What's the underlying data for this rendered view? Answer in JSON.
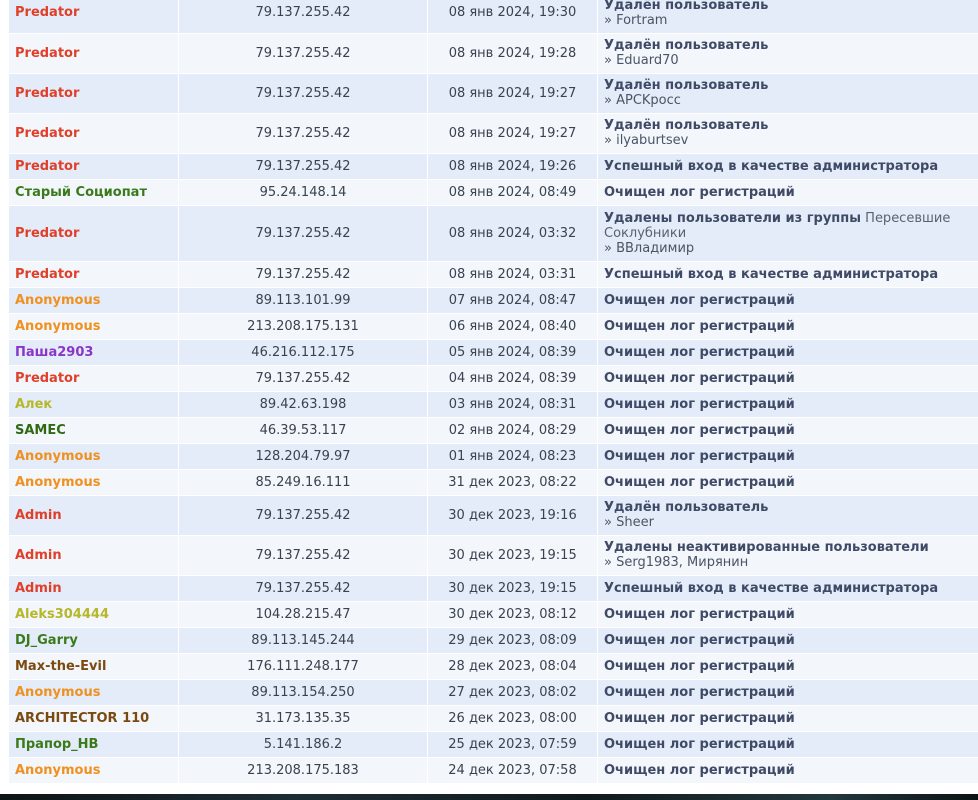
{
  "colors": {
    "predator": "#e0402a",
    "admin": "#e0402a",
    "anonymous": "#f0901f",
    "green": "#3a7a1a",
    "purple": "#8a35c8",
    "olive": "#b5b82a",
    "brown": "#7a4a10"
  },
  "rows": [
    {
      "user": "Predator",
      "color": "#e0402a",
      "ip": "79.137.255.42",
      "time": "08 янв 2024, 19:30",
      "action": "Удалён пользователь",
      "extra": "",
      "sub": "» Fortram",
      "h": 40
    },
    {
      "user": "Predator",
      "color": "#e0402a",
      "ip": "79.137.255.42",
      "time": "08 янв 2024, 19:28",
      "action": "Удалён пользователь",
      "extra": "",
      "sub": "» Eduard70",
      "h": 40
    },
    {
      "user": "Predator",
      "color": "#e0402a",
      "ip": "79.137.255.42",
      "time": "08 янв 2024, 19:27",
      "action": "Удалён пользователь",
      "extra": "",
      "sub": "» APCKpocc",
      "h": 40
    },
    {
      "user": "Predator",
      "color": "#e0402a",
      "ip": "79.137.255.42",
      "time": "08 янв 2024, 19:27",
      "action": "Удалён пользователь",
      "extra": "",
      "sub": "» ilyaburtsev",
      "h": 40
    },
    {
      "user": "Predator",
      "color": "#e0402a",
      "ip": "79.137.255.42",
      "time": "08 янв 2024, 19:26",
      "action": "Успешный вход в качестве администратора",
      "extra": "",
      "sub": "",
      "h": 26
    },
    {
      "user": "Старый Социопат",
      "color": "#3a7a1a",
      "ip": "95.24.148.14",
      "time": "08 янв 2024, 08:49",
      "action": "Очищен лог регистраций",
      "extra": "",
      "sub": "",
      "h": 26
    },
    {
      "user": "Predator",
      "color": "#e0402a",
      "ip": "79.137.255.42",
      "time": "08 янв 2024, 03:32",
      "action": "Удалены пользователи из группы",
      "extra": " Пересевшие Соклубники",
      "sub": "» ВВладимир",
      "h": 56
    },
    {
      "user": "Predator",
      "color": "#e0402a",
      "ip": "79.137.255.42",
      "time": "08 янв 2024, 03:31",
      "action": "Успешный вход в качестве администратора",
      "extra": "",
      "sub": "",
      "h": 26
    },
    {
      "user": "Anonymous",
      "color": "#f0901f",
      "ip": "89.113.101.99",
      "time": "07 янв 2024, 08:47",
      "action": "Очищен лог регистраций",
      "extra": "",
      "sub": "",
      "h": 26
    },
    {
      "user": "Anonymous",
      "color": "#f0901f",
      "ip": "213.208.175.131",
      "time": "06 янв 2024, 08:40",
      "action": "Очищен лог регистраций",
      "extra": "",
      "sub": "",
      "h": 26
    },
    {
      "user": "Паша2903",
      "color": "#8a35c8",
      "ip": "46.216.112.175",
      "time": "05 янв 2024, 08:39",
      "action": "Очищен лог регистраций",
      "extra": "",
      "sub": "",
      "h": 26
    },
    {
      "user": "Predator",
      "color": "#e0402a",
      "ip": "79.137.255.42",
      "time": "04 янв 2024, 08:39",
      "action": "Очищен лог регистраций",
      "extra": "",
      "sub": "",
      "h": 26
    },
    {
      "user": "Алек",
      "color": "#b5b82a",
      "ip": "89.42.63.198",
      "time": "03 янв 2024, 08:31",
      "action": "Очищен лог регистраций",
      "extra": "",
      "sub": "",
      "h": 26
    },
    {
      "user": "SAMEC",
      "color": "#2f6a12",
      "ip": "46.39.53.117",
      "time": "02 янв 2024, 08:29",
      "action": "Очищен лог регистраций",
      "extra": "",
      "sub": "",
      "h": 26
    },
    {
      "user": "Anonymous",
      "color": "#f0901f",
      "ip": "128.204.79.97",
      "time": "01 янв 2024, 08:23",
      "action": "Очищен лог регистраций",
      "extra": "",
      "sub": "",
      "h": 26
    },
    {
      "user": "Anonymous",
      "color": "#f0901f",
      "ip": "85.249.16.111",
      "time": "31 дек 2023, 08:22",
      "action": "Очищен лог регистраций",
      "extra": "",
      "sub": "",
      "h": 26
    },
    {
      "user": "Admin",
      "color": "#e0402a",
      "ip": "79.137.255.42",
      "time": "30 дек 2023, 19:16",
      "action": "Удалён пользователь",
      "extra": "",
      "sub": "» Sheer",
      "h": 40
    },
    {
      "user": "Admin",
      "color": "#e0402a",
      "ip": "79.137.255.42",
      "time": "30 дек 2023, 19:15",
      "action": "Удалены неактивированные пользователи",
      "extra": "",
      "sub": "» Serg1983, Мирянин",
      "h": 40
    },
    {
      "user": "Admin",
      "color": "#e0402a",
      "ip": "79.137.255.42",
      "time": "30 дек 2023, 19:15",
      "action": "Успешный вход в качестве администратора",
      "extra": "",
      "sub": "",
      "h": 26
    },
    {
      "user": "Aleks304444",
      "color": "#b5b82a",
      "ip": "104.28.215.47",
      "time": "30 дек 2023, 08:12",
      "action": "Очищен лог регистраций",
      "extra": "",
      "sub": "",
      "h": 26
    },
    {
      "user": "DJ_Garry",
      "color": "#3a7a1a",
      "ip": "89.113.145.244",
      "time": "29 дек 2023, 08:09",
      "action": "Очищен лог регистраций",
      "extra": "",
      "sub": "",
      "h": 26
    },
    {
      "user": "Max-the-Evil",
      "color": "#7a4a10",
      "ip": "176.111.248.177",
      "time": "28 дек 2023, 08:04",
      "action": "Очищен лог регистраций",
      "extra": "",
      "sub": "",
      "h": 26
    },
    {
      "user": "Anonymous",
      "color": "#f0901f",
      "ip": "89.113.154.250",
      "time": "27 дек 2023, 08:02",
      "action": "Очищен лог регистраций",
      "extra": "",
      "sub": "",
      "h": 26
    },
    {
      "user": "ARCHITECTOR 110",
      "color": "#7a4a10",
      "ip": "31.173.135.35",
      "time": "26 дек 2023, 08:00",
      "action": "Очищен лог регистраций",
      "extra": "",
      "sub": "",
      "h": 26
    },
    {
      "user": "Прапор_НВ",
      "color": "#3a7a1a",
      "ip": "5.141.186.2",
      "time": "25 дек 2023, 07:59",
      "action": "Очищен лог регистраций",
      "extra": "",
      "sub": "",
      "h": 26
    },
    {
      "user": "Anonymous",
      "color": "#f0901f",
      "ip": "213.208.175.183",
      "time": "24 дек 2023, 07:58",
      "action": "Очищен лог регистраций",
      "extra": "",
      "sub": "",
      "h": 26
    }
  ]
}
